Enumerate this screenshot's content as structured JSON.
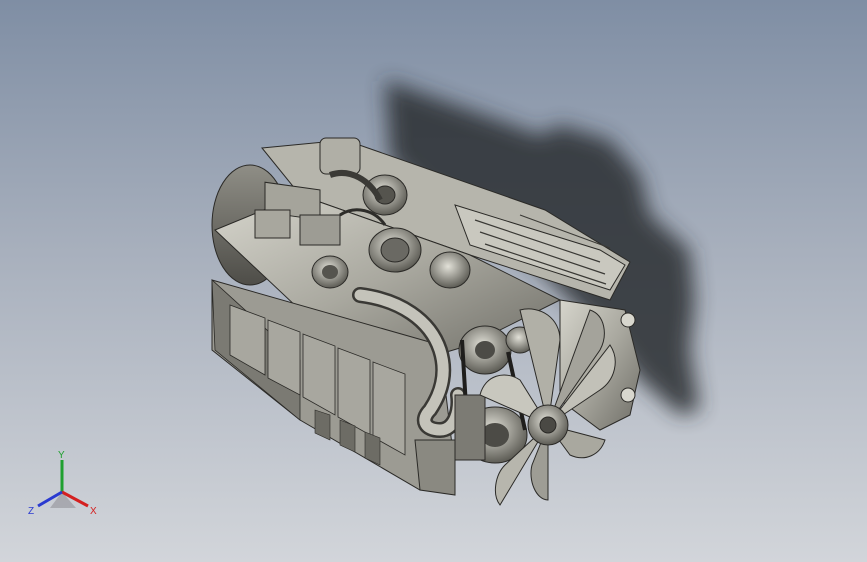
{
  "viewport": {
    "model_name": "engine-assembly",
    "colors": {
      "background_top": "#7f8ea4",
      "background_bottom": "#d2d5da",
      "metal": "#b8b7ad",
      "shadow": "#2a2d33"
    }
  },
  "triad": {
    "y_label": "Y",
    "x_label": "X",
    "z_label": "Z",
    "colors": {
      "x": "#d42020",
      "y": "#20a030",
      "z": "#2a3ad0"
    }
  }
}
